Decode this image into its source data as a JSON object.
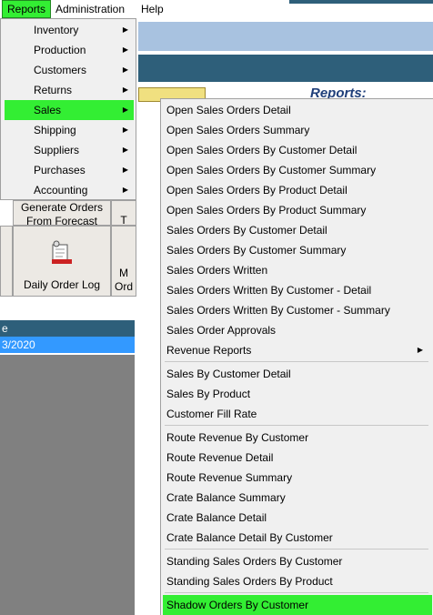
{
  "menubar": {
    "reports": "Reports",
    "administration": "Administration",
    "help": "Help"
  },
  "background": {
    "reports_title": "Reports:",
    "tile_generate_line1": "Generate Orders",
    "tile_generate_line2": "From Forecast",
    "tile_t": "T",
    "tile_daily_order_log": "Daily Order Log",
    "tile_m_line1": "M",
    "tile_m_line2": "Ord",
    "grid_header": "e",
    "grid_row": "3/2020",
    "colors": {
      "blue_band": "#a8c2e0",
      "dark_band": "#2e5f7a",
      "selection": "#3399ff",
      "highlight": "#33ee33"
    }
  },
  "reports_menu": {
    "items": [
      {
        "label": "Inventory",
        "has_submenu": true,
        "arrow": "▶"
      },
      {
        "label": "Production",
        "has_submenu": true,
        "arrow": "▶"
      },
      {
        "label": "Customers",
        "has_submenu": true,
        "arrow": "▶"
      },
      {
        "label": "Returns",
        "has_submenu": true,
        "arrow": "▶"
      },
      {
        "label": "Sales",
        "has_submenu": true,
        "active": true,
        "arrow": "▶"
      },
      {
        "label": "Shipping",
        "has_submenu": true,
        "arrow": "▶"
      },
      {
        "label": "Suppliers",
        "has_submenu": true,
        "arrow": "▶"
      },
      {
        "label": "Purchases",
        "has_submenu": true,
        "arrow": "▶"
      },
      {
        "label": "Accounting",
        "has_submenu": true,
        "arrow": "▶"
      }
    ]
  },
  "sales_menu": {
    "items": [
      "Open Sales Orders Detail",
      "Open Sales Orders Summary",
      "Open Sales Orders By Customer Detail",
      "Open Sales Orders By Customer Summary",
      "Open Sales Orders By Product Detail",
      "Open Sales Orders By Product Summary",
      "Sales Orders By Customer Detail",
      "Sales Orders By Customer Summary",
      "Sales Orders Written",
      "Sales Orders Written By Customer - Detail",
      "Sales Orders Written By Customer - Summary",
      "Sales Order Approvals",
      "Revenue Reports",
      "Sales By Customer Detail",
      "Sales By Product",
      "Customer Fill Rate",
      "Route Revenue By Customer",
      "Route Revenue Detail",
      "Route Revenue Summary",
      "Crate Balance Summary",
      "Crate Balance Detail",
      "Crate Balance Detail By Customer",
      "Standing Sales Orders By Customer",
      "Standing Sales Orders By Product",
      "Shadow Orders By Customer"
    ],
    "revenue_reports_arrow": "▶"
  }
}
